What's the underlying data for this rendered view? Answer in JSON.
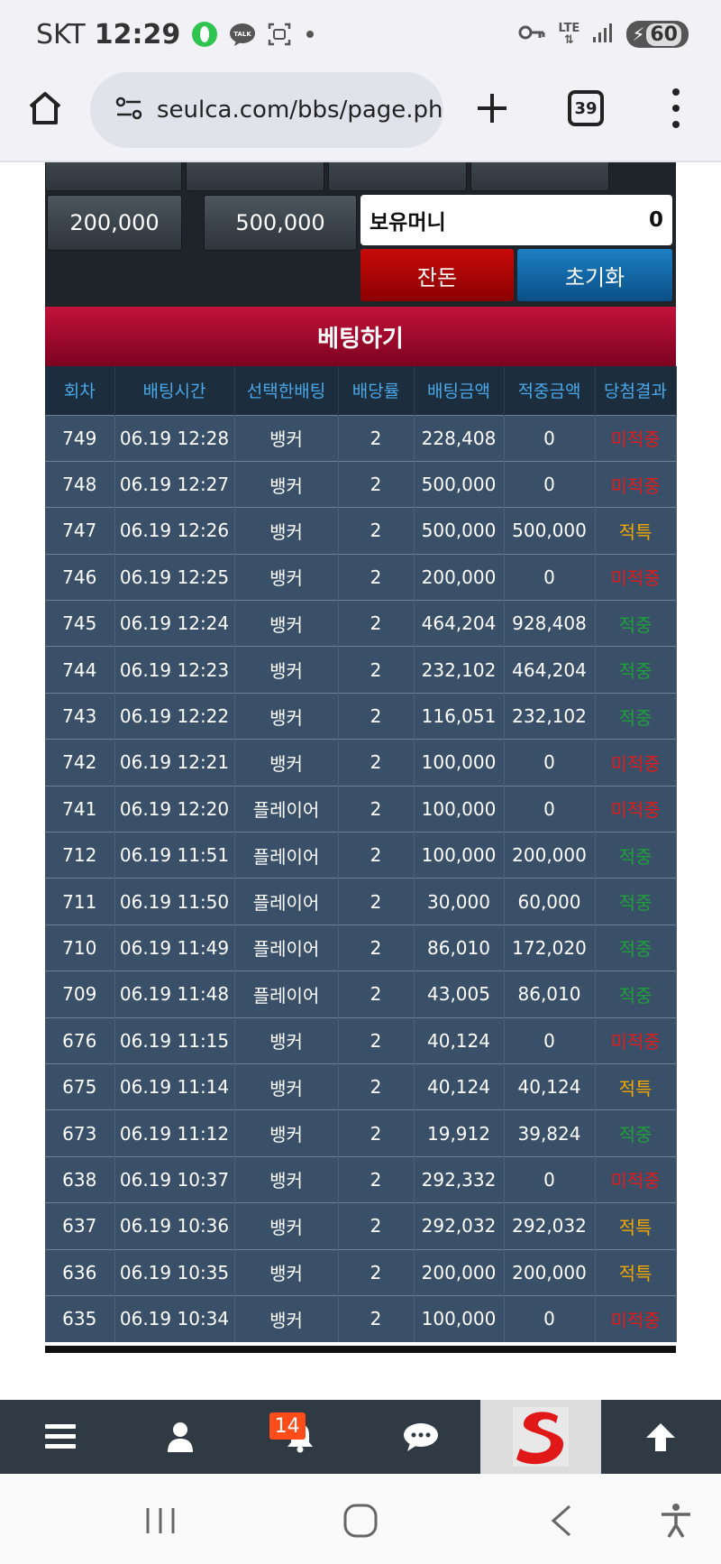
{
  "status_bar": {
    "carrier": "SKT",
    "time": "12:29",
    "talk_label": "TALK",
    "network": "LTE",
    "battery": "60"
  },
  "browser": {
    "url": "seulca.com/bbs/page.php",
    "tab_count": "39"
  },
  "chips": {
    "row2": [
      "200,000",
      "500,000"
    ]
  },
  "money": {
    "label": "보유머니",
    "value": "0"
  },
  "buttons": {
    "change": "잔돈",
    "reset": "초기화"
  },
  "bet_header": "베팅하기",
  "table": {
    "headers": [
      "회차",
      "배팅시간",
      "선택한배팅",
      "배당률",
      "배팅금액",
      "적중금액",
      "당첨결과"
    ],
    "rows": [
      {
        "round": "749",
        "time": "06.19 12:28",
        "pick": "뱅커",
        "odds": "2",
        "bet": "228,408",
        "win": "0",
        "result": "미적중",
        "status": "miss"
      },
      {
        "round": "748",
        "time": "06.19 12:27",
        "pick": "뱅커",
        "odds": "2",
        "bet": "500,000",
        "win": "0",
        "result": "미적중",
        "status": "miss"
      },
      {
        "round": "747",
        "time": "06.19 12:26",
        "pick": "뱅커",
        "odds": "2",
        "bet": "500,000",
        "win": "500,000",
        "result": "적특",
        "status": "hit"
      },
      {
        "round": "746",
        "time": "06.19 12:25",
        "pick": "뱅커",
        "odds": "2",
        "bet": "200,000",
        "win": "0",
        "result": "미적중",
        "status": "miss"
      },
      {
        "round": "745",
        "time": "06.19 12:24",
        "pick": "뱅커",
        "odds": "2",
        "bet": "464,204",
        "win": "928,408",
        "result": "적중",
        "status": "win"
      },
      {
        "round": "744",
        "time": "06.19 12:23",
        "pick": "뱅커",
        "odds": "2",
        "bet": "232,102",
        "win": "464,204",
        "result": "적중",
        "status": "win"
      },
      {
        "round": "743",
        "time": "06.19 12:22",
        "pick": "뱅커",
        "odds": "2",
        "bet": "116,051",
        "win": "232,102",
        "result": "적중",
        "status": "win"
      },
      {
        "round": "742",
        "time": "06.19 12:21",
        "pick": "뱅커",
        "odds": "2",
        "bet": "100,000",
        "win": "0",
        "result": "미적중",
        "status": "miss"
      },
      {
        "round": "741",
        "time": "06.19 12:20",
        "pick": "플레이어",
        "odds": "2",
        "bet": "100,000",
        "win": "0",
        "result": "미적중",
        "status": "miss"
      },
      {
        "round": "712",
        "time": "06.19 11:51",
        "pick": "플레이어",
        "odds": "2",
        "bet": "100,000",
        "win": "200,000",
        "result": "적중",
        "status": "win"
      },
      {
        "round": "711",
        "time": "06.19 11:50",
        "pick": "플레이어",
        "odds": "2",
        "bet": "30,000",
        "win": "60,000",
        "result": "적중",
        "status": "win"
      },
      {
        "round": "710",
        "time": "06.19 11:49",
        "pick": "플레이어",
        "odds": "2",
        "bet": "86,010",
        "win": "172,020",
        "result": "적중",
        "status": "win"
      },
      {
        "round": "709",
        "time": "06.19 11:48",
        "pick": "플레이어",
        "odds": "2",
        "bet": "43,005",
        "win": "86,010",
        "result": "적중",
        "status": "win"
      },
      {
        "round": "676",
        "time": "06.19 11:15",
        "pick": "뱅커",
        "odds": "2",
        "bet": "40,124",
        "win": "0",
        "result": "미적중",
        "status": "miss"
      },
      {
        "round": "675",
        "time": "06.19 11:14",
        "pick": "뱅커",
        "odds": "2",
        "bet": "40,124",
        "win": "40,124",
        "result": "적특",
        "status": "hit"
      },
      {
        "round": "673",
        "time": "06.19 11:12",
        "pick": "뱅커",
        "odds": "2",
        "bet": "19,912",
        "win": "39,824",
        "result": "적중",
        "status": "win"
      },
      {
        "round": "638",
        "time": "06.19 10:37",
        "pick": "뱅커",
        "odds": "2",
        "bet": "292,332",
        "win": "0",
        "result": "미적중",
        "status": "miss"
      },
      {
        "round": "637",
        "time": "06.19 10:36",
        "pick": "뱅커",
        "odds": "2",
        "bet": "292,032",
        "win": "292,032",
        "result": "적특",
        "status": "hit"
      },
      {
        "round": "636",
        "time": "06.19 10:35",
        "pick": "뱅커",
        "odds": "2",
        "bet": "200,000",
        "win": "200,000",
        "result": "적특",
        "status": "hit"
      },
      {
        "round": "635",
        "time": "06.19 10:34",
        "pick": "뱅커",
        "odds": "2",
        "bet": "100,000",
        "win": "0",
        "result": "미적중",
        "status": "miss"
      }
    ]
  },
  "site_nav": {
    "notification_count": "14",
    "items": [
      "menu-icon",
      "user-icon",
      "bell-icon",
      "chat-icon",
      "site-logo",
      "arrow-up-icon"
    ]
  },
  "colors": {
    "miss": "#e21b1b",
    "win": "#1fa03a",
    "hit": "#f0a800",
    "header_red": "#b0102e",
    "table_row": "#3a5068"
  }
}
